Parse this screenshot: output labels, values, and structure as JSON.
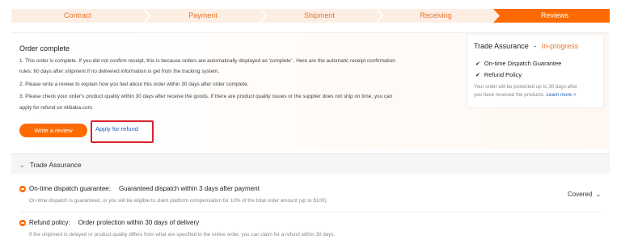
{
  "steps": [
    {
      "label": "Contract",
      "active": false
    },
    {
      "label": "Payment",
      "active": false
    },
    {
      "label": "Shipment",
      "active": false
    },
    {
      "label": "Receiving",
      "active": false
    },
    {
      "label": "Reviews",
      "active": true
    }
  ],
  "order": {
    "title": "Order complete",
    "lines": [
      "1. This order is complete. If you did not confirm receipt, this is because orders are automatically displayed as 'complete' . Here are the automatic receipt confirmation",
      "rules: 60 days after shipment if no delivered information is get from the tracking system.",
      "2. Please write a review to explain how you feel about this order within 30 days after order complete.",
      "3. Please check your order's product quality within 30 days after receive the goods. If there are product quality issues or the supplier does not ship on time, you can",
      "apply for refund on Alibaba.com."
    ],
    "write_review_label": "Write a review",
    "apply_refund_label": "Apply for refund"
  },
  "trade_assurance_box": {
    "title": "Trade Assurance",
    "separator": "-",
    "status": "In-progress",
    "items": [
      "On-time Dispatch Guarantee",
      "Refund Policy"
    ],
    "note_line1": "Your order will be protected up to 30 days after",
    "note_line2": "you have received the products.",
    "learn_more": "Learn more >"
  },
  "trade_assurance_section": {
    "title": "Trade Assurance",
    "rows": [
      {
        "label": "On-time dispatch guarantee:",
        "value": "Guaranteed dispatch within 3 days after payment",
        "desc": "On-time dispatch is guaranteed, or you will be eligible to claim platform compensation for 10% of the total order amount (up to $100)."
      },
      {
        "label": "Refund policy:",
        "value": "Order protection within 30 days of delivery",
        "desc": "If the shipment is delayed or product quality differs from what are specified in the online order, you can claim for a refund within 30 days."
      }
    ],
    "covered_label": "Covered"
  },
  "colors": {
    "accent": "#ff6a00",
    "step_text": "#e8732a",
    "step_bg": "#fdeee4",
    "link": "#1f5fb8",
    "highlight_border": "#d9232d"
  }
}
